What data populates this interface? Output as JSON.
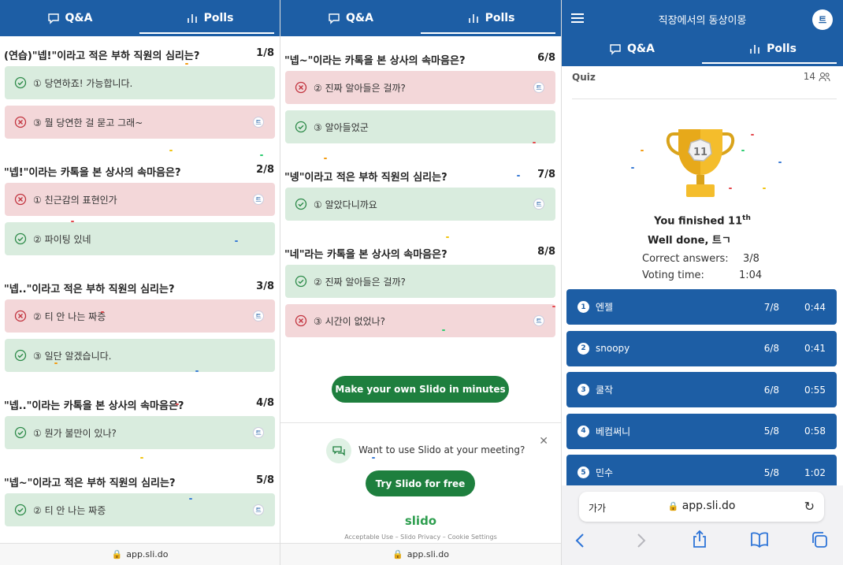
{
  "tabs": {
    "qa": "Q&A",
    "polls": "Polls"
  },
  "panel1": {
    "questions": [
      {
        "title": "(연습)\"넵!\"이라고 적은 부하 직원의 심리는?",
        "count": "1/8",
        "options": [
          {
            "label": "① 당연하죠! 가능합니다.",
            "correct": true,
            "avatar": ""
          },
          {
            "label": "③ 뭘 당연한 걸 묻고 그래~",
            "correct": false,
            "avatar": "트"
          }
        ]
      },
      {
        "title": "\"넵!\"이라는 카톡을 본 상사의 속마음은?",
        "count": "2/8",
        "options": [
          {
            "label": "① 친근감의 표현인가",
            "correct": false,
            "avatar": "트"
          },
          {
            "label": "② 파이팅 있네",
            "correct": true,
            "avatar": ""
          }
        ]
      },
      {
        "title": "\"넵..\"이라고 적은 부하 직원의 심리는?",
        "count": "3/8",
        "options": [
          {
            "label": "② 티 안 나는 짜증",
            "correct": false,
            "avatar": "트"
          },
          {
            "label": "③ 일단 알겠습니다.",
            "correct": true,
            "avatar": ""
          }
        ]
      },
      {
        "title": "\"넵..\"이라는 카톡을 본 상사의 속마음은?",
        "count": "4/8",
        "options": [
          {
            "label": "① 뭔가 불만이 있나?",
            "correct": true,
            "avatar": "트"
          }
        ]
      },
      {
        "title": "\"넵~\"이라고 적은 부하 직원의 심리는?",
        "count": "5/8",
        "options": [
          {
            "label": "② 티 안 나는 짜증",
            "correct": true,
            "avatar": "트"
          }
        ]
      }
    ],
    "url": "app.sli.do"
  },
  "panel2": {
    "questions": [
      {
        "title": "\"넵~\"이라는 카톡을 본 상사의 속마음은?",
        "count": "6/8",
        "options": [
          {
            "label": "② 진짜 알아들은 걸까?",
            "correct": false,
            "avatar": "트"
          },
          {
            "label": "③ 알아들었군",
            "correct": true,
            "avatar": ""
          }
        ]
      },
      {
        "title": "\"넹\"이라고 적은 부하 직원의 심리는?",
        "count": "7/8",
        "options": [
          {
            "label": "① 알았다니까요",
            "correct": true,
            "avatar": "트"
          }
        ]
      },
      {
        "title": "\"네\"라는 카톡을 본 상사의 속마음은?",
        "count": "8/8",
        "options": [
          {
            "label": "② 진짜 알아들은 걸까?",
            "correct": true,
            "avatar": ""
          },
          {
            "label": "③ 시간이 없었나?",
            "correct": false,
            "avatar": "트"
          }
        ]
      }
    ],
    "make_button": "Make your own Slido in minutes",
    "promo_text": "Want to use Slido at your meeting?",
    "try_button": "Try Slido for free",
    "brand": "slido",
    "footer_links": [
      "Acceptable Use",
      "Slido Privacy",
      "Cookie Settings"
    ],
    "url": "app.sli.do"
  },
  "panel3": {
    "event_title": "직장에서의 동상이몽",
    "avatar": "트",
    "quiz_label": "Quiz",
    "participants": "14",
    "trophy_rank": "11",
    "finished_text": "You finished 11",
    "finished_sup": "th",
    "well_done": "Well done, 트ㄱ",
    "correct_label": "Correct answers:",
    "correct_value": "3/8",
    "voting_label": "Voting time:",
    "voting_value": "1:04",
    "leaderboard": [
      {
        "rank": "1",
        "name": "엔젤",
        "score": "7/8",
        "time": "0:44"
      },
      {
        "rank": "2",
        "name": "snoopy",
        "score": "6/8",
        "time": "0:41"
      },
      {
        "rank": "3",
        "name": "쿨작",
        "score": "6/8",
        "time": "0:55"
      },
      {
        "rank": "4",
        "name": "베컴써니",
        "score": "5/8",
        "time": "0:58"
      },
      {
        "rank": "5",
        "name": "민수",
        "score": "5/8",
        "time": "1:02"
      }
    ],
    "browser": {
      "text_size": "가가",
      "url": "app.sli.do"
    }
  },
  "colors": {
    "brand_blue": "#1d5ea5",
    "correct_bg": "#d9ecde",
    "wrong_bg": "#f3d7d9",
    "slido_green": "#1e7f3e"
  }
}
